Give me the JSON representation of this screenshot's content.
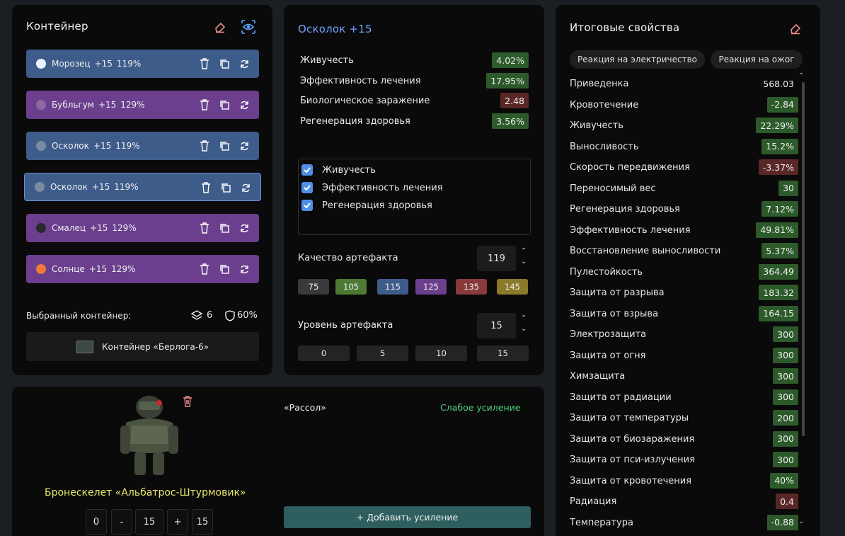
{
  "container": {
    "title": "Контейнер",
    "items": [
      {
        "name": "Морозец",
        "level": "+15",
        "quality": "119%",
        "color": "#3e5c8a"
      },
      {
        "name": "Бубльгум",
        "level": "+15",
        "quality": "129%",
        "color": "#6b3f8e"
      },
      {
        "name": "Осколок",
        "level": "+15",
        "quality": "119%",
        "color": "#3e5c8a"
      },
      {
        "name": "Осколок",
        "level": "+15",
        "quality": "119%",
        "color": "#3e5c8a"
      },
      {
        "name": "Смалец",
        "level": "+15",
        "quality": "129%",
        "color": "#6b3f8e"
      },
      {
        "name": "Солнце",
        "level": "+15",
        "quality": "129%",
        "color": "#6b3f8e"
      }
    ],
    "selected_label": "Выбранный контейнер:",
    "slots": "6",
    "protection": "60%",
    "container_name": "Контейнер «Берлога-6»"
  },
  "artifact": {
    "title": "Осколок +15",
    "stats": [
      {
        "label": "Живучесть",
        "value": "4.02%",
        "kind": "g"
      },
      {
        "label": "Эффективность лечения",
        "value": "17.95%",
        "kind": "g"
      },
      {
        "label": "Биологическое заражение",
        "value": "2.48",
        "kind": "r"
      },
      {
        "label": "Регенерация здоровья",
        "value": "3.56%",
        "kind": "g"
      }
    ],
    "checks": [
      "Живучесть",
      "Эффективность лечения",
      "Регенерация здоровья"
    ],
    "quality_label": "Качество артефакта",
    "quality_value": "119",
    "quality_presets": [
      {
        "label": "75",
        "color": "#3a3a3a"
      },
      {
        "label": "105",
        "color": "#4e7a34"
      },
      {
        "label": "115",
        "color": "#3e5c8a"
      },
      {
        "label": "125",
        "color": "#6b3f8e"
      },
      {
        "label": "135",
        "color": "#8a3a3a"
      },
      {
        "label": "145",
        "color": "#8a7a2a"
      }
    ],
    "level_label": "Уровень артефакта",
    "level_value": "15",
    "level_presets": [
      "0",
      "5",
      "10",
      "15"
    ]
  },
  "armor": {
    "name": "Бронескелет «Альбатрос-Штурмовик»",
    "controls": [
      "0",
      "-",
      "15",
      "+",
      "15"
    ],
    "upgrade_name": "«Рассол»",
    "upgrade_status": "Слабое усиление",
    "add_button": "+ Добавить усиление"
  },
  "totals": {
    "title": "Итоговые свойства",
    "tabs": [
      "Реакция на электричество",
      "Реакция на ожог"
    ],
    "stats": [
      {
        "label": "Приведенка",
        "value": "568.03",
        "kind": "none"
      },
      {
        "label": "Кровотечение",
        "value": "-2.84",
        "kind": "g"
      },
      {
        "label": "Живучесть",
        "value": "22.29%",
        "kind": "g"
      },
      {
        "label": "Выносливость",
        "value": "15.2%",
        "kind": "g"
      },
      {
        "label": "Скорость передвижения",
        "value": "-3.37%",
        "kind": "r"
      },
      {
        "label": "Переносимый вес",
        "value": "30",
        "kind": "g"
      },
      {
        "label": "Регенерация здоровья",
        "value": "7.12%",
        "kind": "g"
      },
      {
        "label": "Эффективность лечения",
        "value": "49.81%",
        "kind": "g"
      },
      {
        "label": "Восстановление выносливости",
        "value": "5.37%",
        "kind": "g"
      },
      {
        "label": "Пулестойкость",
        "value": "364.49",
        "kind": "g"
      },
      {
        "label": "Защита от разрыва",
        "value": "183.32",
        "kind": "g"
      },
      {
        "label": "Защита от взрыва",
        "value": "164.15",
        "kind": "g"
      },
      {
        "label": "Электрозащита",
        "value": "300",
        "kind": "g"
      },
      {
        "label": "Защита от огня",
        "value": "300",
        "kind": "g"
      },
      {
        "label": "Химзащита",
        "value": "300",
        "kind": "g"
      },
      {
        "label": "Защита от радиации",
        "value": "300",
        "kind": "g"
      },
      {
        "label": "Защита от температуры",
        "value": "200",
        "kind": "g"
      },
      {
        "label": "Защита от биозаражения",
        "value": "300",
        "kind": "g"
      },
      {
        "label": "Защита от пси-излучения",
        "value": "300",
        "kind": "g"
      },
      {
        "label": "Защита от кровотечения",
        "value": "40%",
        "kind": "g"
      },
      {
        "label": "Радиация",
        "value": "0.4",
        "kind": "r"
      },
      {
        "label": "Температура",
        "value": "-0.88",
        "kind": "g"
      }
    ]
  }
}
